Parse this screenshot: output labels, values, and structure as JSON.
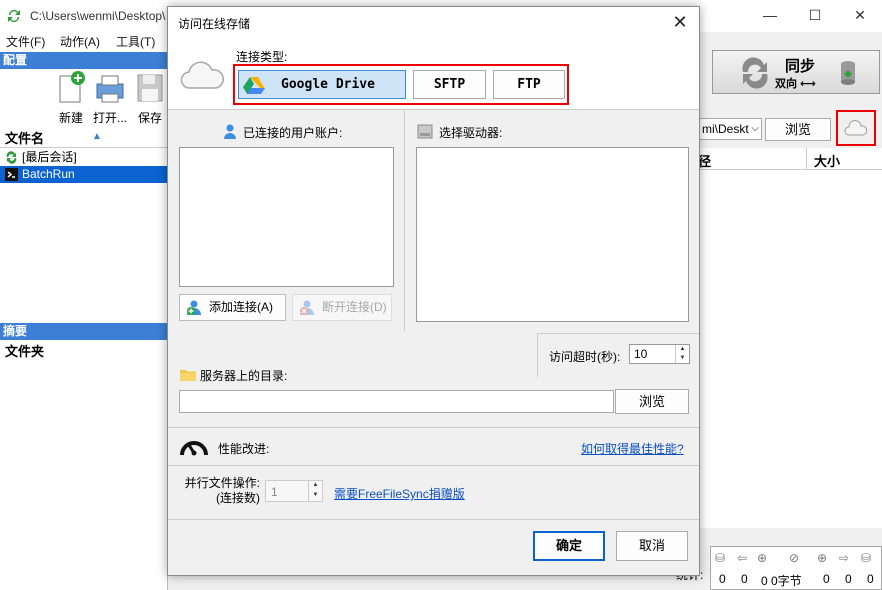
{
  "main_window": {
    "title": "C:\\Users\\wenmi\\Desktop\\",
    "menu": [
      "文件(F)",
      "动作(A)",
      "工具(T)"
    ],
    "config_header": "配置",
    "toolbar": {
      "new_label": "新建",
      "open_label": "打开...",
      "save_label": "保存"
    },
    "file_name_header": "文件名",
    "config_items": [
      {
        "label": "[最后会话]"
      },
      {
        "label": "BatchRun"
      }
    ],
    "summary_header": "摘要",
    "folder_header": "文件夹",
    "sync_label": "同步",
    "sync_mode": "双向 ⟷",
    "path_value": "mi\\Deskt",
    "browse_label": "浏览",
    "grid_headers": [
      "径",
      "大小"
    ],
    "stats_label": "统计:",
    "stats_values": [
      "0",
      "0",
      "0 0字节",
      "0",
      "0",
      "0"
    ]
  },
  "dialog": {
    "title": "访问在线存储",
    "connection_type_label": "连接类型:",
    "types": [
      {
        "label": "Google Drive",
        "active": true
      },
      {
        "label": "SFTP",
        "active": false
      },
      {
        "label": "FTP",
        "active": false
      }
    ],
    "connected_accounts_label": "已连接的用户账户:",
    "select_drive_label": "选择驱动器:",
    "add_connection_label": "添加连接(A)",
    "disconnect_label": "断开连接(D)",
    "timeout_label": "访问超时(秒):",
    "timeout_value": "10",
    "server_dir_label": "服务器上的目录:",
    "server_dir_value": "",
    "browse_label": "浏览",
    "performance_label": "性能改进:",
    "performance_link": "如何取得最佳性能?",
    "parallel_label_line1": "并行文件操作:",
    "parallel_label_line2": "(连接数)",
    "parallel_value": "1",
    "donation_link": "需要FreeFileSync捐赠版",
    "ok_label": "确定",
    "cancel_label": "取消"
  },
  "colors": {
    "accent": "#0a63d0",
    "section_header": "#3d7fd6",
    "highlight_frame": "#ee0000",
    "link": "#0b4fc4"
  }
}
